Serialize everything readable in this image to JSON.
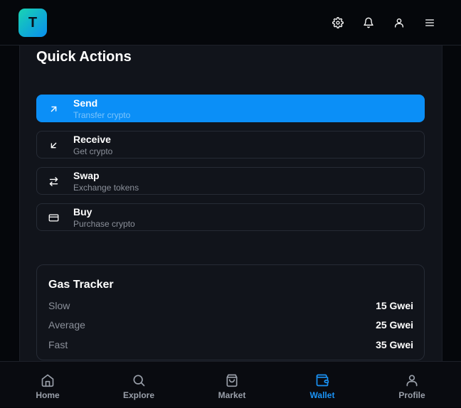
{
  "app": {
    "logo_letter": "T"
  },
  "header": {
    "icons": [
      "gear-icon",
      "bell-icon",
      "user-icon",
      "menu-icon"
    ]
  },
  "quick_actions": {
    "title": "Quick Actions",
    "items": [
      {
        "label": "Send",
        "subtitle": "Transfer crypto",
        "icon": "arrow-up-right-icon",
        "active": true
      },
      {
        "label": "Receive",
        "subtitle": "Get crypto",
        "icon": "arrow-down-left-icon",
        "active": false
      },
      {
        "label": "Swap",
        "subtitle": "Exchange tokens",
        "icon": "swap-icon",
        "active": false
      },
      {
        "label": "Buy",
        "subtitle": "Purchase crypto",
        "icon": "credit-card-icon",
        "active": false
      }
    ]
  },
  "gas_tracker": {
    "title": "Gas Tracker",
    "rows": [
      {
        "name": "Slow",
        "value": "15 Gwei"
      },
      {
        "name": "Average",
        "value": "25 Gwei"
      },
      {
        "name": "Fast",
        "value": "35 Gwei"
      }
    ]
  },
  "bottom_nav": {
    "items": [
      {
        "label": "Home",
        "icon": "home-icon",
        "active": false
      },
      {
        "label": "Explore",
        "icon": "search-icon",
        "active": false
      },
      {
        "label": "Market",
        "icon": "shopping-bag-icon",
        "active": false
      },
      {
        "label": "Wallet",
        "icon": "wallet-icon",
        "active": true
      },
      {
        "label": "Profile",
        "icon": "user-icon",
        "active": false
      }
    ]
  },
  "colors": {
    "accent": "#0b8ff7",
    "background": "#05070b",
    "panel": "#11141b",
    "muted_text": "#8b909a"
  }
}
